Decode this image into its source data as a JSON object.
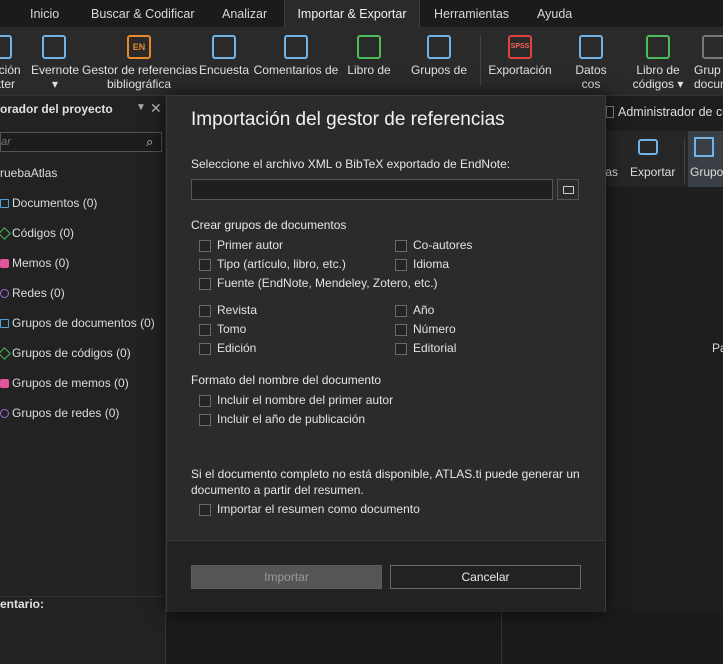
{
  "menu": {
    "tabs": [
      {
        "label": "Inicio"
      },
      {
        "label": "Buscar & Codificar"
      },
      {
        "label": "Analizar"
      },
      {
        "label": "Importar & Exportar"
      },
      {
        "label": "Herramientas"
      },
      {
        "label": "Ayuda"
      }
    ],
    "active_tab": "Importar & Exportar"
  },
  "ribbon": {
    "items": [
      {
        "line1": "ación",
        "line2": "tter"
      },
      {
        "line1": "Evernote",
        "line2": "▾"
      },
      {
        "line1": "Gestor de referencias",
        "line2": "bibliográfica"
      },
      {
        "line1": "Encuesta",
        "line2": ""
      },
      {
        "line1": "Comentarios de",
        "line2": ""
      },
      {
        "line1": "Libro de",
        "line2": ""
      },
      {
        "line1": "Grupos de",
        "line2": ""
      },
      {
        "line1": "Exportación",
        "line2": ""
      },
      {
        "line1": "Datos",
        "line2": "cos"
      },
      {
        "line1": "Libro de",
        "line2": "códigos ▾"
      },
      {
        "line1": "Grup",
        "line2": "docum"
      }
    ],
    "spss_badge": "SPSS",
    "en_badge": "EN"
  },
  "left_panel": {
    "title": "orador del proyecto",
    "search_placeholder": "ar",
    "project_name": "ruebaAtlas",
    "items": [
      {
        "label": "Documentos (0)",
        "color": "#4aa3df"
      },
      {
        "label": "Códigos (0)",
        "color": "#4cbb5a"
      },
      {
        "label": "Memos (0)",
        "color": "#e0559b"
      },
      {
        "label": "Redes (0)",
        "color": "#9b6fd6"
      },
      {
        "label": "Grupos de documentos (0)",
        "color": "#4aa3df"
      },
      {
        "label": "Grupos de códigos (0)",
        "color": "#4cbb5a"
      },
      {
        "label": "Grupos de memos (0)",
        "color": "#e0559b"
      },
      {
        "label": "Grupos de redes (0)",
        "color": "#9b6fd6"
      }
    ],
    "comment_label": "entario:"
  },
  "background": {
    "admin_label": "Administrador de có",
    "mini_toolbar": {
      "left_label": "tas",
      "export_label": "Exportar",
      "groups_label": "Grupo"
    },
    "right_text": "Pa"
  },
  "dialog": {
    "title": "Importación del gestor de referencias",
    "file_label": "Seleccione el archivo XML o BibTeX exportado de EndNote:",
    "file_value": "",
    "groups_title": "Crear grupos de documentos",
    "group_options": [
      {
        "label": "Primer autor",
        "checked": false
      },
      {
        "label": "Co-autores",
        "checked": false
      },
      {
        "label": "Tipo (artículo, libro, etc.)",
        "checked": false
      },
      {
        "label": "Idioma",
        "checked": false
      },
      {
        "label": "Fuente (EndNote, Mendeley, Zotero, etc.)",
        "checked": false
      },
      {
        "label": "Revista",
        "checked": false
      },
      {
        "label": "Año",
        "checked": false
      },
      {
        "label": "Tomo",
        "checked": false
      },
      {
        "label": "Número",
        "checked": false
      },
      {
        "label": "Edición",
        "checked": false
      },
      {
        "label": "Editorial",
        "checked": false
      }
    ],
    "name_format_title": "Formato del nombre del documento",
    "name_options": [
      {
        "label": "Incluir el nombre del primer autor",
        "checked": false
      },
      {
        "label": "Incluir el año de publicación",
        "checked": false
      }
    ],
    "abstract_note_line1": "Si el documento completo no está disponible, ATLAS.ti puede generar un",
    "abstract_note_line2": "documento a partir del resumen.",
    "abstract_option": {
      "label": "Importar el resumen como documento",
      "checked": false
    },
    "import_button": "Importar",
    "cancel_button": "Cancelar"
  }
}
